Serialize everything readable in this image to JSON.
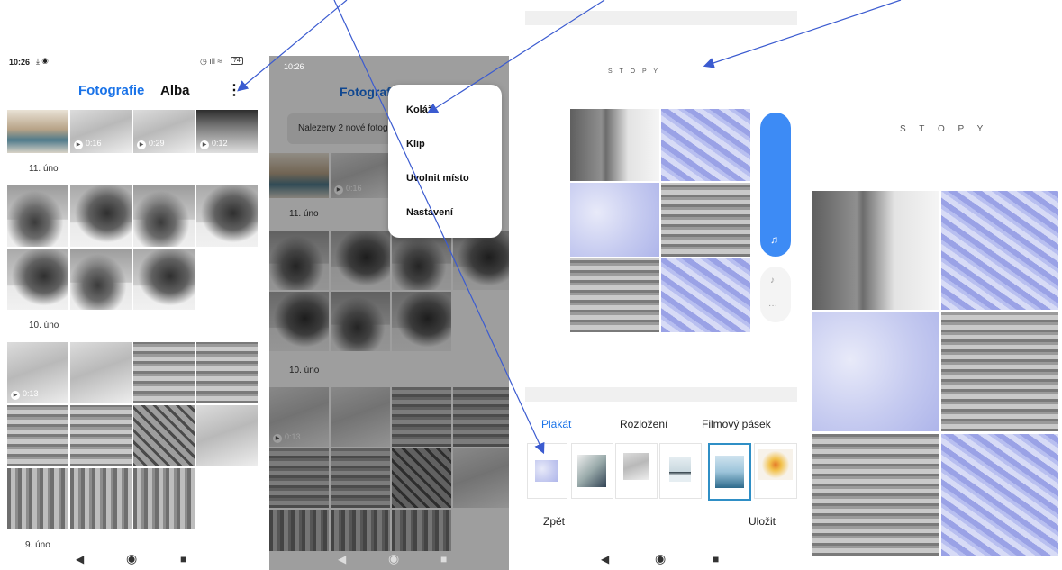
{
  "screen1": {
    "time": "10:26",
    "battery": "74",
    "tabs": {
      "photos": "Fotografie",
      "albums": "Alba"
    },
    "video_durations": [
      "0:16",
      "0:29",
      "0:12"
    ],
    "video_duration_row3": "0:13",
    "dates": [
      "11. úno",
      "10. úno",
      "9. úno"
    ]
  },
  "screen2": {
    "time": "10:26",
    "title": "Fotografie",
    "banner": "Nalezeny 2 nové fotog",
    "dates": [
      "11. úno",
      "10. úno"
    ],
    "video_duration": "0:16",
    "video_duration_row3": "0:13",
    "menu": [
      "Koláž",
      "Klip",
      "Uvolnit místo",
      "Nastavení"
    ]
  },
  "screen3": {
    "collage_title": "S T O P Y",
    "tabs": [
      "Plakát",
      "Rozložení",
      "Filmový pásek"
    ],
    "back": "Zpět",
    "save": "Uložit"
  },
  "screen4": {
    "collage_title": "S T O P Y"
  },
  "colors": {
    "accent": "#1a73e8",
    "arrow": "#3b5bd0",
    "side_panel": "#3d8bf5"
  }
}
